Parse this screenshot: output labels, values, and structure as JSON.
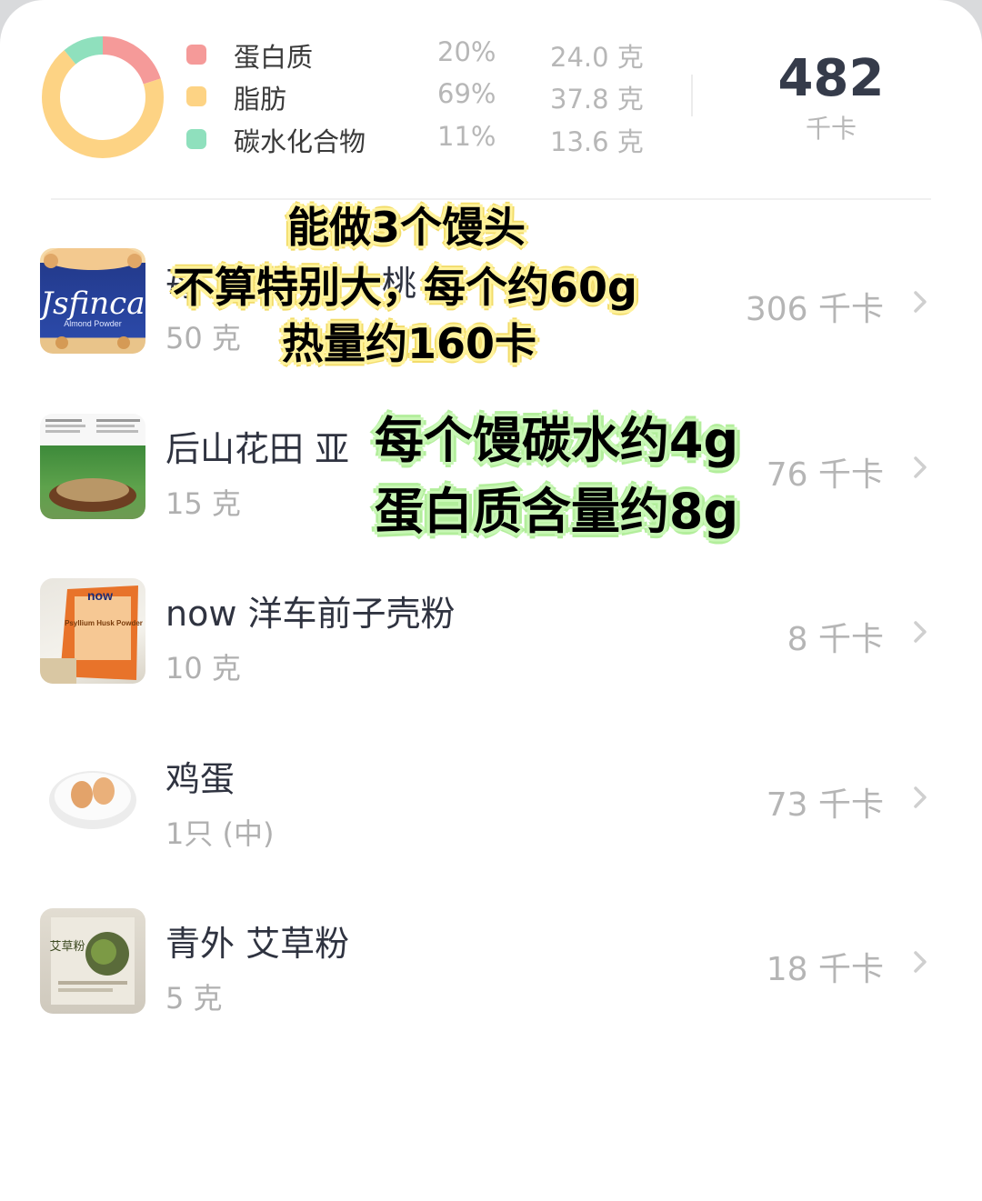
{
  "summary": {
    "macros": [
      {
        "name": "蛋白质",
        "percent": "20%",
        "amount": "24.0 克",
        "color": "#f59a99",
        "fraction": 0.2
      },
      {
        "name": "脂肪",
        "percent": "69%",
        "amount": "37.8 克",
        "color": "#fdd384",
        "fraction": 0.69
      },
      {
        "name": "碳水化合物",
        "percent": "11%",
        "amount": "13.6 克",
        "color": "#8fe0bd",
        "fraction": 0.11
      }
    ],
    "total_kcal": "482",
    "kcal_unit": "千卡"
  },
  "foods": [
    {
      "name": "苺",
      "name_tail": "桃",
      "quantity": "50 克",
      "kcal": "306 千卡",
      "thumb_text": "Jsfinca",
      "thumb_sub": "Almond Powder"
    },
    {
      "name": "后山花田 亚",
      "quantity": "15 克",
      "kcal": "76 千卡"
    },
    {
      "name": "now 洋车前子壳粉",
      "quantity": "10 克",
      "kcal": "8 千卡",
      "thumb_text": "now",
      "thumb_sub": "Psyllium Husk Powder"
    },
    {
      "name": "鸡蛋",
      "quantity": "1只 (中)",
      "kcal": "73 千卡"
    },
    {
      "name": "青外 艾草粉",
      "quantity": "5 克",
      "kcal": "18 千卡",
      "thumb_text": "艾草粉"
    }
  ],
  "overlays": {
    "yellow": [
      "能做3个馒头",
      "不算特别大，每个约60g",
      "热量约160卡"
    ],
    "green": [
      "每个馒碳水约4g",
      "蛋白质含量约8g"
    ]
  },
  "colors": {
    "protein": "#f59a99",
    "fat": "#fdd384",
    "carb": "#8fe0bd",
    "accent_text": "#353b4a"
  }
}
